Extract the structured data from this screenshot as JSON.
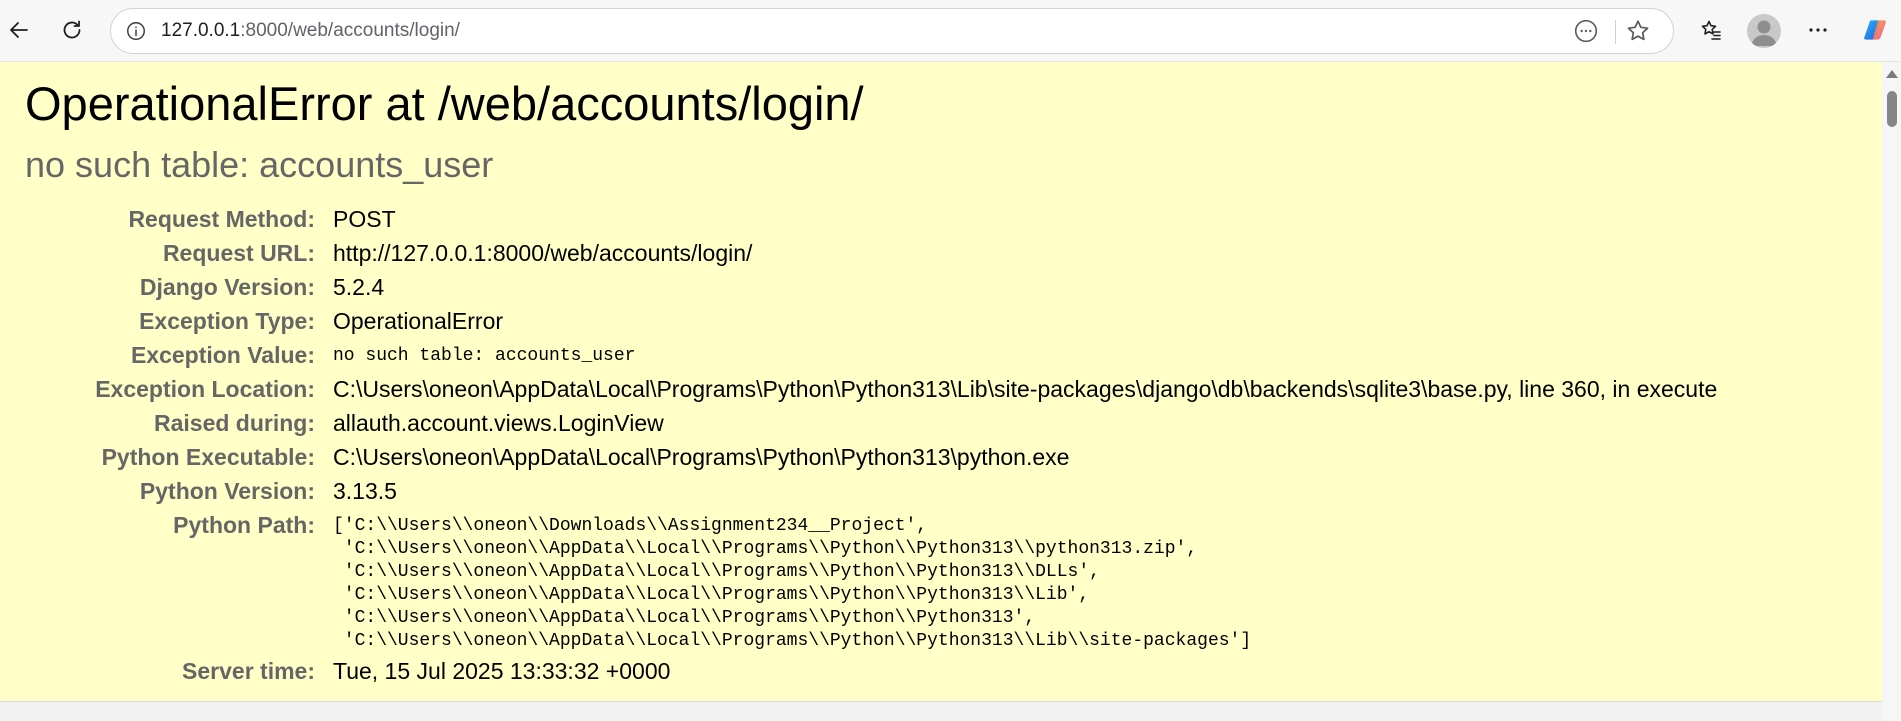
{
  "browser": {
    "url_host": "127.0.0.1",
    "url_path": ":8000/web/accounts/login/",
    "icons": [
      "back-arrow-icon",
      "refresh-icon",
      "site-info-icon",
      "read-aloud-icon",
      "star-icon",
      "favorites-icon",
      "profile-icon",
      "more-icon",
      "copilot-icon"
    ]
  },
  "error": {
    "title": "OperationalError at /web/accounts/login/",
    "subtitle": "no such table: accounts_user"
  },
  "meta": [
    {
      "label": "Request Method:",
      "value": "POST"
    },
    {
      "label": "Request URL:",
      "value": "http://127.0.0.1:8000/web/accounts/login/"
    },
    {
      "label": "Django Version:",
      "value": "5.2.4"
    },
    {
      "label": "Exception Type:",
      "value": "OperationalError"
    },
    {
      "label": "Exception Value:",
      "value": "no such table: accounts_user"
    },
    {
      "label": "Exception Location:",
      "value": "C:\\Users\\oneon\\AppData\\Local\\Programs\\Python\\Python313\\Lib\\site-packages\\django\\db\\backends\\sqlite3\\base.py, line 360, in execute"
    },
    {
      "label": "Raised during:",
      "value": "allauth.account.views.LoginView"
    },
    {
      "label": "Python Executable:",
      "value": "C:\\Users\\oneon\\AppData\\Local\\Programs\\Python\\Python313\\python.exe"
    },
    {
      "label": "Python Version:",
      "value": "3.13.5"
    },
    {
      "label": "Python Path:",
      "value": "['C:\\\\Users\\\\oneon\\\\Downloads\\\\Assignment234__Project',\n 'C:\\\\Users\\\\oneon\\\\AppData\\\\Local\\\\Programs\\\\Python\\\\Python313\\\\python313.zip',\n 'C:\\\\Users\\\\oneon\\\\AppData\\\\Local\\\\Programs\\\\Python\\\\Python313\\\\DLLs',\n 'C:\\\\Users\\\\oneon\\\\AppData\\\\Local\\\\Programs\\\\Python\\\\Python313\\\\Lib',\n 'C:\\\\Users\\\\oneon\\\\AppData\\\\Local\\\\Programs\\\\Python\\\\Python313',\n 'C:\\\\Users\\\\oneon\\\\AppData\\\\Local\\\\Programs\\\\Python\\\\Python313\\\\Lib\\\\site-packages']"
    },
    {
      "label": "Server time:",
      "value": "Tue, 15 Jul 2025 13:33:32 +0000"
    }
  ]
}
